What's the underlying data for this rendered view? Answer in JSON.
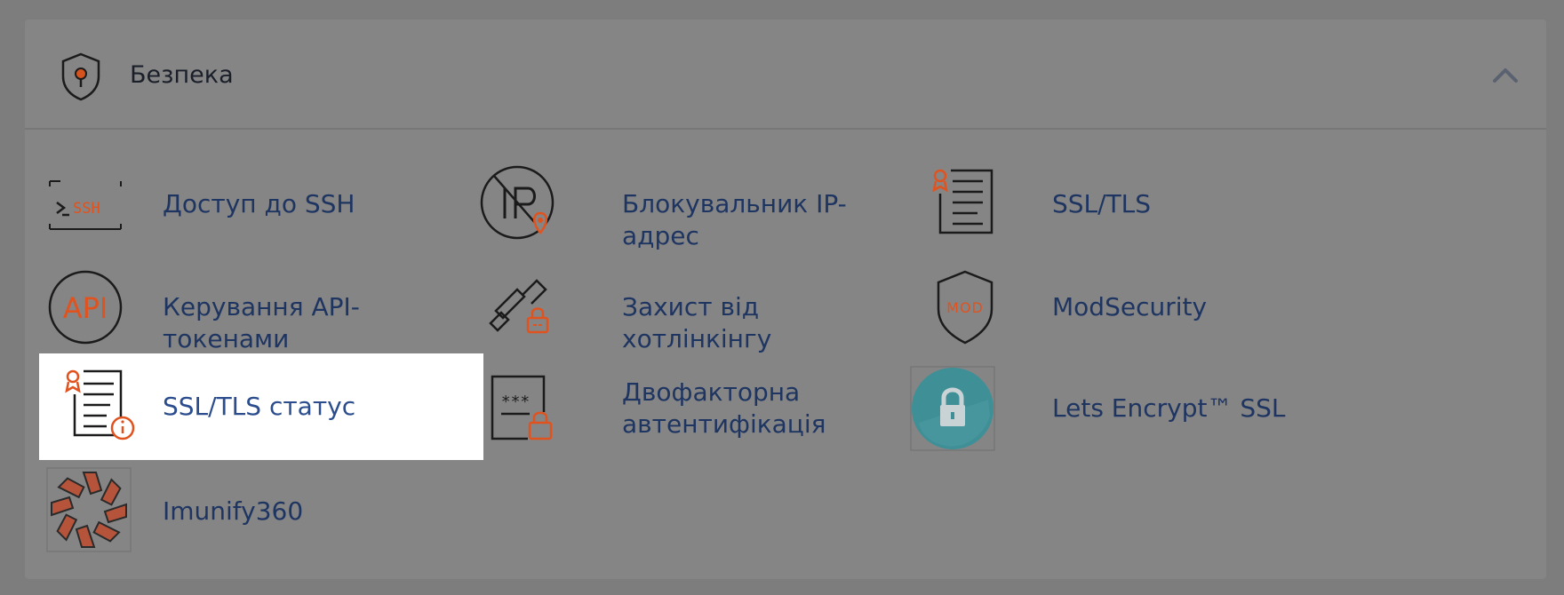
{
  "section": {
    "title": "Безпека",
    "header_icon": "shield-pin-icon",
    "collapse_icon": "chevron-up-icon"
  },
  "items": [
    {
      "label": "Доступ до SSH",
      "icon": "ssh-terminal-icon"
    },
    {
      "label": "Блокувальник IP-адрес",
      "icon": "ip-blocker-icon"
    },
    {
      "label": "SSL/TLS",
      "icon": "ssl-certificate-icon"
    },
    {
      "label": "Керування API-токенами",
      "icon": "api-icon"
    },
    {
      "label": "Захист від хотлінкінгу",
      "icon": "hotlink-protection-icon"
    },
    {
      "label": "ModSecurity",
      "icon": "modsecurity-shield-icon"
    },
    {
      "label": "SSL/TLS статус",
      "icon": "ssl-status-icon",
      "selected": true
    },
    {
      "label_line1": "Двофакторна",
      "label_line2": "автентифікація",
      "icon": "two-factor-icon"
    },
    {
      "label": "Lets Encrypt™ SSL",
      "icon": "lets-encrypt-lock-icon"
    },
    {
      "label": "Imunify360",
      "icon": "imunify360-logo-icon"
    }
  ],
  "colors": {
    "accent_orange": "#e0531f",
    "label_blue": "#1f3561",
    "panel_bg": "#858585",
    "page_bg": "#7d7d7d",
    "selected_bg": "#ffffff"
  }
}
